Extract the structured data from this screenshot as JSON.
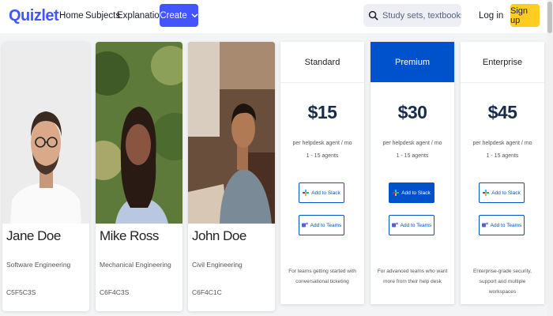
{
  "nav": {
    "logo": "Quizlet",
    "links": [
      "Home",
      "Subjects",
      "Explanations"
    ],
    "create_label": "Create",
    "search_placeholder": "Study sets, textbooks, ...",
    "login_label": "Log in",
    "signup_label": "Sign up",
    "brand_color": "#4255ff",
    "signup_color": "#ffcd1f"
  },
  "people": [
    {
      "name": "Jane Doe",
      "role": "Software Engineering",
      "id": "C5F5C3S"
    },
    {
      "name": "Mike Ross",
      "role": "Mechanical Engineering",
      "id": "C6F4C3S"
    },
    {
      "name": "John Doe",
      "role": "Civil Engineering",
      "id": "C6F4C1C"
    }
  ],
  "plans": [
    {
      "name": "Standard",
      "price": "$15",
      "per": "per helpdesk agent / mo",
      "agents": "1 - 15 agents",
      "slack": "Add to Slack",
      "teams": "Add to Teams",
      "desc": "For teams getting started with conversational ticketing"
    },
    {
      "name": "Premium",
      "price": "$30",
      "per": "per helpdesk agent / mo",
      "agents": "1 - 15 agents",
      "slack": "Add to Slack",
      "teams": "Add to Teams",
      "desc": "For advanced teams who want more from their help desk"
    },
    {
      "name": "Enterprise",
      "price": "$45",
      "per": "per helpdesk agent / mo",
      "agents": "1 - 15 agents",
      "slack": "Add to Slack",
      "teams": "Add to Teams",
      "desc": "Enterprise-grade security, support and multiple workspaces"
    }
  ],
  "icons": {
    "search": "search-icon",
    "chevron": "chevron-down-icon",
    "slack": "slack-icon",
    "teams": "teams-icon"
  },
  "accent": "#0052cc"
}
